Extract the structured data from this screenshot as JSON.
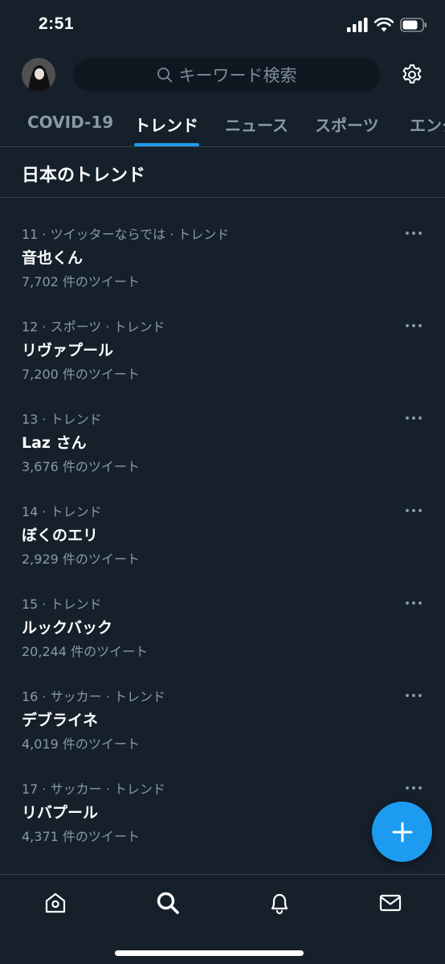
{
  "status_bar": {
    "time": "2:51"
  },
  "header": {
    "search_placeholder": "キーワード検索"
  },
  "tabs": [
    {
      "label": "COVID-19",
      "active": false
    },
    {
      "label": "トレンド",
      "active": true
    },
    {
      "label": "ニュース",
      "active": false
    },
    {
      "label": "スポーツ",
      "active": false
    },
    {
      "label": "エンタ",
      "active": false
    }
  ],
  "section": {
    "title": "日本のトレンド"
  },
  "trends": [
    {
      "meta": "11 · ツイッターならでは · トレンド",
      "name": "音也くん",
      "count": "7,702 件のツイート"
    },
    {
      "meta": "12 · スポーツ · トレンド",
      "name": "リヴァプール",
      "count": "7,200 件のツイート"
    },
    {
      "meta": "13 · トレンド",
      "name": "Laz さん",
      "count": "3,676 件のツイート"
    },
    {
      "meta": "14 · トレンド",
      "name": "ぼくのエリ",
      "count": "2,929 件のツイート"
    },
    {
      "meta": "15 · トレンド",
      "name": "ルックバック",
      "count": "20,244 件のツイート"
    },
    {
      "meta": "16 · サッカー · トレンド",
      "name": "デブライネ",
      "count": "4,019 件のツイート"
    },
    {
      "meta": "17 · サッカー · トレンド",
      "name": "リバプール",
      "count": "4,371 件のツイート"
    }
  ],
  "bottom_nav": [
    {
      "icon": "home-icon"
    },
    {
      "icon": "search-icon"
    },
    {
      "icon": "bell-icon"
    },
    {
      "icon": "mail-icon"
    }
  ],
  "colors": {
    "background": "#15202b",
    "accent": "#1d9bf0",
    "secondary_text": "#8899a6",
    "divider": "#38444d"
  }
}
